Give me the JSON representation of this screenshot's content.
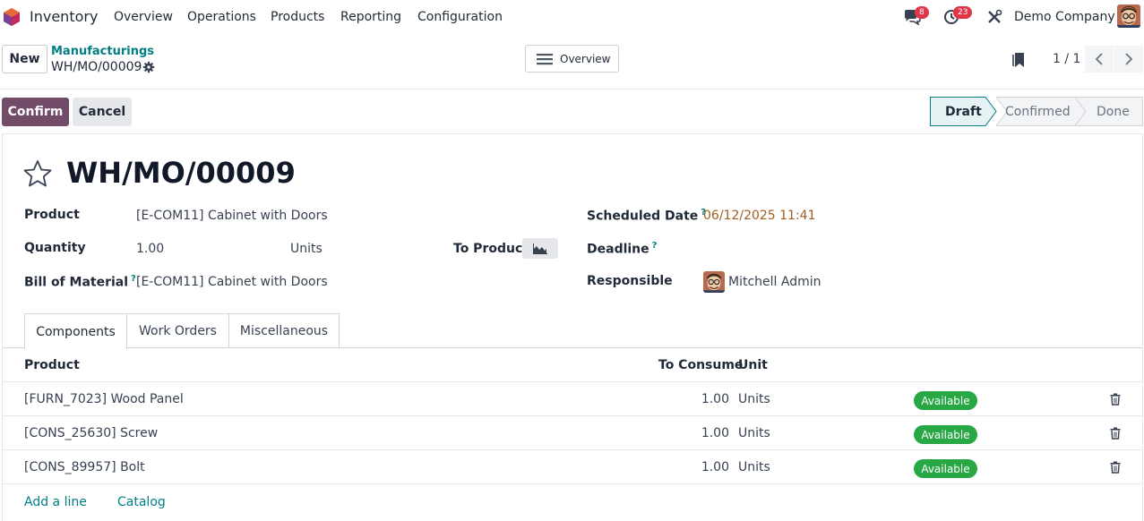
{
  "navbar": {
    "app_name": "Inventory",
    "menu": [
      "Overview",
      "Operations",
      "Products",
      "Reporting",
      "Configuration"
    ],
    "messages_count": "8",
    "activities_count": "23",
    "company": "Demo Company"
  },
  "control": {
    "new_label": "New",
    "breadcrumb_parent": "Manufacturings",
    "breadcrumb_current": "WH/MO/00009",
    "overview_label": "Overview",
    "pager": "1 / 1"
  },
  "statusbar": {
    "confirm_label": "Confirm",
    "cancel_label": "Cancel",
    "stages": [
      "Draft",
      "Confirmed",
      "Done"
    ],
    "active_stage": "Draft"
  },
  "form": {
    "title": "WH/MO/00009",
    "product_label": "Product",
    "product_value": "[E-COM11] Cabinet with Doors",
    "quantity_label": "Quantity",
    "quantity_value": "1.00",
    "quantity_unit": "Units",
    "to_produce_label": "To Produce",
    "bom_label": "Bill of Material",
    "bom_value": "[E-COM11] Cabinet with Doors",
    "scheduled_label": "Scheduled Date",
    "scheduled_value": "06/12/2025 11:41",
    "deadline_label": "Deadline",
    "responsible_label": "Responsible",
    "responsible_value": "Mitchell Admin",
    "help_mark": "?"
  },
  "tabs": [
    "Components",
    "Work Orders",
    "Miscellaneous"
  ],
  "components": {
    "headers": [
      "Product",
      "To Consume",
      "Unit"
    ],
    "rows": [
      {
        "product": "[FURN_7023] Wood Panel",
        "qty": "1.00",
        "unit": "Units",
        "status": "Available"
      },
      {
        "product": "[CONS_25630] Screw",
        "qty": "1.00",
        "unit": "Units",
        "status": "Available"
      },
      {
        "product": "[CONS_89957] Bolt",
        "qty": "1.00",
        "unit": "Units",
        "status": "Available"
      }
    ],
    "add_line": "Add a line",
    "catalog": "Catalog"
  },
  "colors": {
    "brand": "#714b67",
    "link": "#017e84",
    "available": "#28a745",
    "badge": "#e0364a",
    "date": "#a15d1c"
  },
  "icons": [
    "app-logo-icon",
    "chat-icon",
    "clock-icon",
    "tools-icon",
    "gear-icon",
    "menu-icon",
    "bookmark-icon",
    "chevron-left-icon",
    "chevron-right-icon",
    "star-icon",
    "area-chart-icon",
    "trash-icon"
  ]
}
